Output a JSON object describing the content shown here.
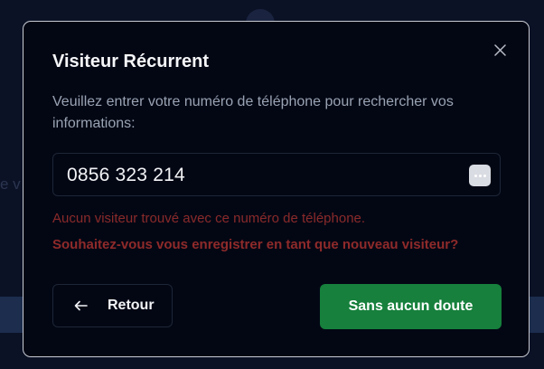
{
  "dialog": {
    "title": "Visiteur Récurrent",
    "description": "Veuillez entrer votre numéro de téléphone pour rechercher vos informations:",
    "phone_value": "0856 323 214",
    "error_message": "Aucun visiteur trouvé avec ce numéro de téléphone.",
    "register_prompt": "Souhaitez-vous vous enregistrer en tant que nouveau visiteur?",
    "back_label": "Retour",
    "confirm_label": "Sans aucun doute"
  },
  "icons": {
    "close": "close-icon",
    "back": "arrow-left-icon",
    "autofill": "more-horizontal-icon"
  },
  "colors": {
    "overlay": "#0b1226",
    "dialog_background": "#030714",
    "error": "#8a2a2a",
    "confirm_button": "#16803c"
  }
}
